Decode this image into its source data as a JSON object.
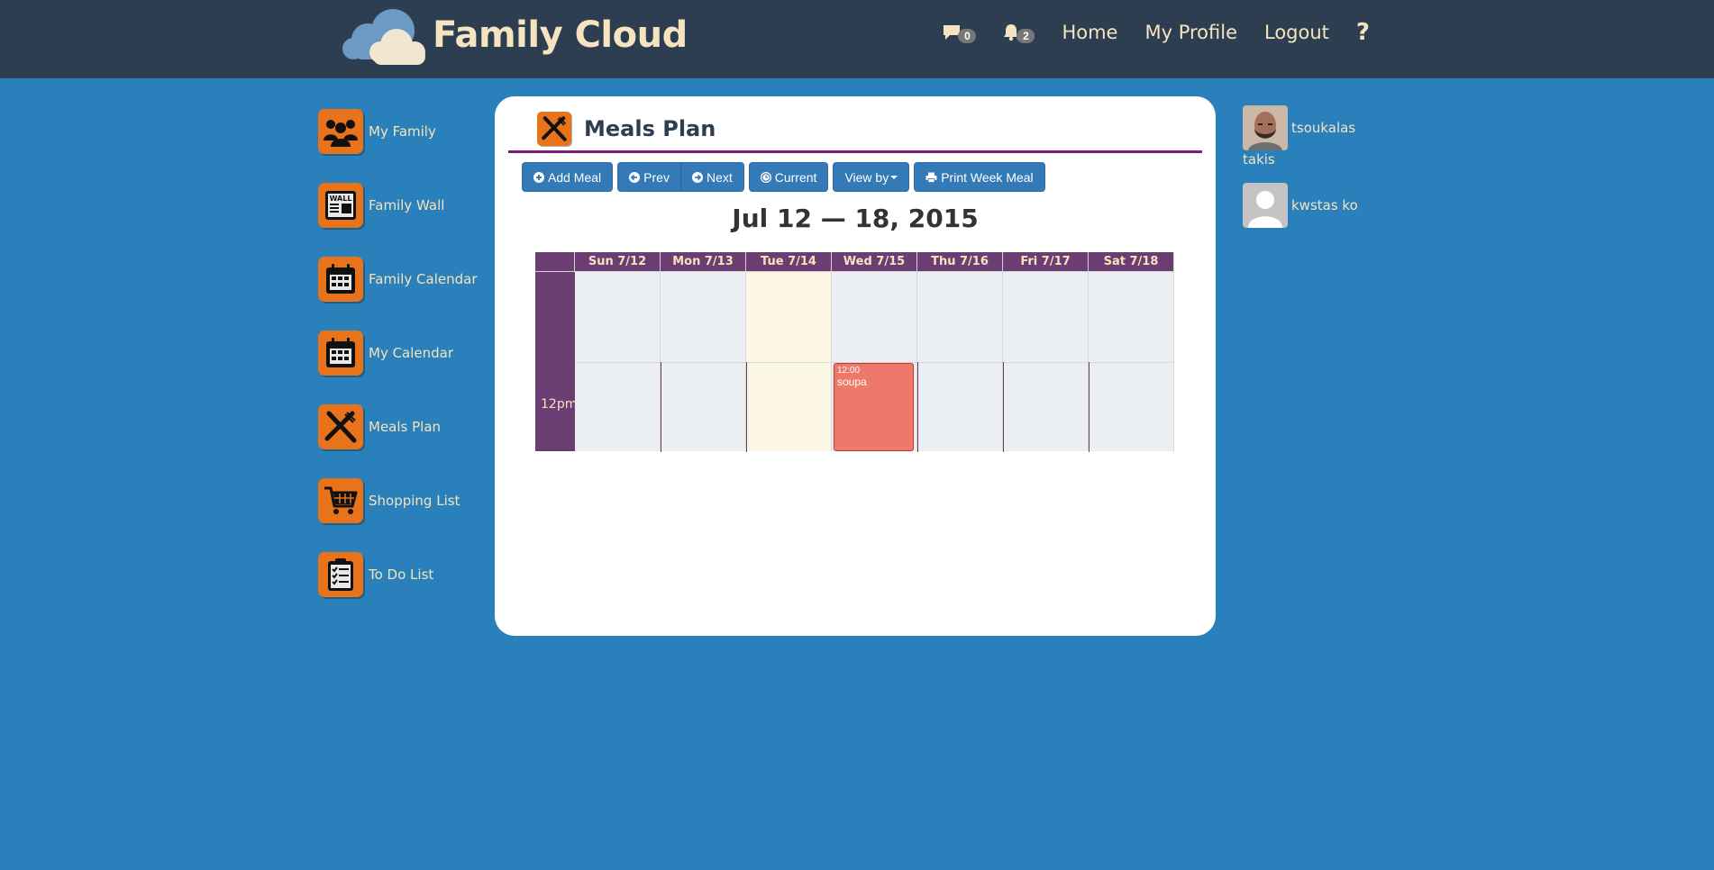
{
  "brand": {
    "title": "Family Cloud"
  },
  "nav": {
    "messages_count": "0",
    "notifications_count": "2",
    "home": "Home",
    "profile": "My Profile",
    "logout": "Logout",
    "help": "?"
  },
  "sidebar": {
    "items": [
      {
        "label": "My Family",
        "icon": "family-icon"
      },
      {
        "label": "Family Wall",
        "icon": "wall-icon"
      },
      {
        "label": "Family Calendar",
        "icon": "calendar-icon"
      },
      {
        "label": "My Calendar",
        "icon": "calendar-icon"
      },
      {
        "label": "Meals Plan",
        "icon": "fork-knife-icon"
      },
      {
        "label": "Shopping List",
        "icon": "cart-icon"
      },
      {
        "label": "To Do List",
        "icon": "checklist-icon"
      }
    ]
  },
  "main": {
    "title": "Meals Plan",
    "toolbar": {
      "add": "Add Meal",
      "prev": "Prev",
      "next": "Next",
      "current": "Current",
      "view_by": "View by",
      "print": "Print Week Meal"
    },
    "week_title": "Jul 12 — 18, 2015",
    "calendar": {
      "days": [
        "Sun 7/12",
        "Mon 7/13",
        "Tue 7/14",
        "Wed 7/15",
        "Thu 7/16",
        "Fri 7/17",
        "Sat 7/18"
      ],
      "today_index": 2,
      "time_label": "12pm",
      "event": {
        "day_index": 3,
        "time": "12:00",
        "title": "soupa",
        "color": "#ee786a"
      }
    }
  },
  "users": [
    {
      "first": "tsoukalas",
      "second": "takis",
      "avatar": "photo-avatar"
    },
    {
      "first": "kwstas ko",
      "second": "",
      "avatar": "placeholder-avatar"
    }
  ],
  "colors": {
    "background": "#2a80ba",
    "navbar": "#2c3e50",
    "accent_text": "#f6e3bf",
    "icon_orange": "#e8731a",
    "calendar_header": "#6b3d72",
    "header_rule": "#7b1e7a",
    "button": "#337ab7"
  }
}
